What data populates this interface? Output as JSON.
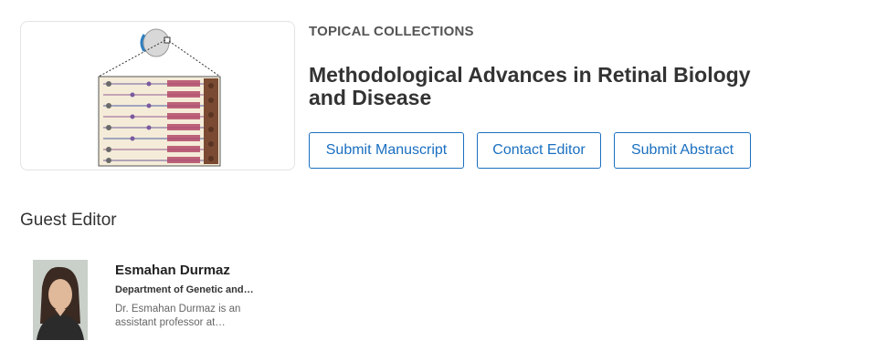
{
  "collection": {
    "eyebrow": "TOPICAL COLLECTIONS",
    "title": "Methodological Advances in Retinal Biology and Disease",
    "image_alt": "retina-illustration"
  },
  "actions": {
    "submit_manuscript": "Submit Manuscript",
    "contact_editor": "Contact Editor",
    "submit_abstract": "Submit Abstract"
  },
  "guest_editor": {
    "heading": "Guest Editor",
    "name": "Esmahan Durmaz",
    "department": "Department of Genetic and…",
    "bio": "Dr. Esmahan Durmaz is an assistant professor at…"
  },
  "colors": {
    "accent": "#1a6fc0",
    "heading": "#333333",
    "muted": "#666666"
  }
}
